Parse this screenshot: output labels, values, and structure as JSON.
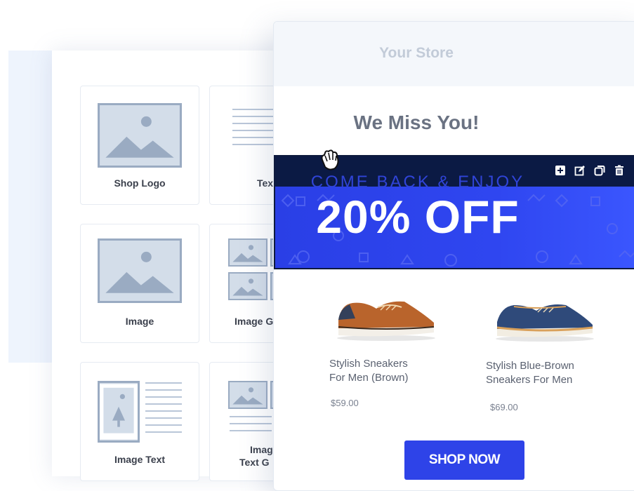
{
  "builder": {
    "blocks": [
      {
        "label": "Shop Logo"
      },
      {
        "label": "Tex"
      },
      {
        "label": "Image"
      },
      {
        "label": "Image G"
      },
      {
        "label": "Image Text"
      },
      {
        "label_line1": "Imag",
        "label_line2": "Text G"
      }
    ]
  },
  "email": {
    "store_name": "Your Store",
    "headline": "We Miss You!",
    "banner": {
      "subtitle": "COME BACK & ENJOY",
      "offer": "20% OFF",
      "toolbar_icons": [
        "add-icon",
        "edit-icon",
        "duplicate-icon",
        "delete-icon"
      ]
    },
    "products": [
      {
        "name_line1": "Stylish Sneakers",
        "name_line2": "For Men (Brown)",
        "price": "$59.00"
      },
      {
        "name_line1": "Stylish Blue-Brown",
        "name_line2": "Sneakers For Men",
        "price": "$69.00"
      }
    ],
    "cta_label": "SHOP NOW"
  },
  "colors": {
    "accent": "#2e43e8",
    "toolbar": "#0b1a44",
    "placeholder": "#cfd9e6"
  }
}
